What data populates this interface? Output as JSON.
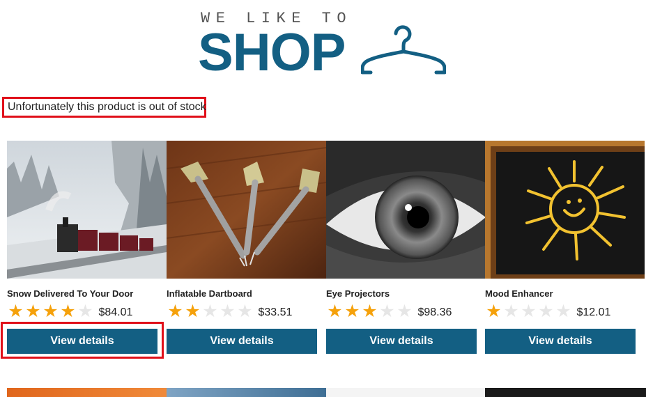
{
  "logo": {
    "tagline": "WE LIKE TO",
    "word": "SHOP",
    "icon": "hanger-icon"
  },
  "notice": "Unfortunately this product is out of stock",
  "products": [
    {
      "name": "Snow Delivered To Your Door",
      "rating": 4,
      "price": "$84.01",
      "button": "View details",
      "image": "snow-train-image"
    },
    {
      "name": "Inflatable Dartboard",
      "rating": 2,
      "price": "$33.51",
      "button": "View details",
      "image": "darts-image"
    },
    {
      "name": "Eye Projectors",
      "rating": 3,
      "price": "$98.36",
      "button": "View details",
      "image": "eye-image"
    },
    {
      "name": "Mood Enhancer",
      "rating": 1,
      "price": "$12.01",
      "button": "View details",
      "image": "sun-chalkboard-image"
    }
  ],
  "colors": {
    "brand": "#135f83",
    "star": "#f5a10b",
    "highlight": "#e0101a"
  }
}
